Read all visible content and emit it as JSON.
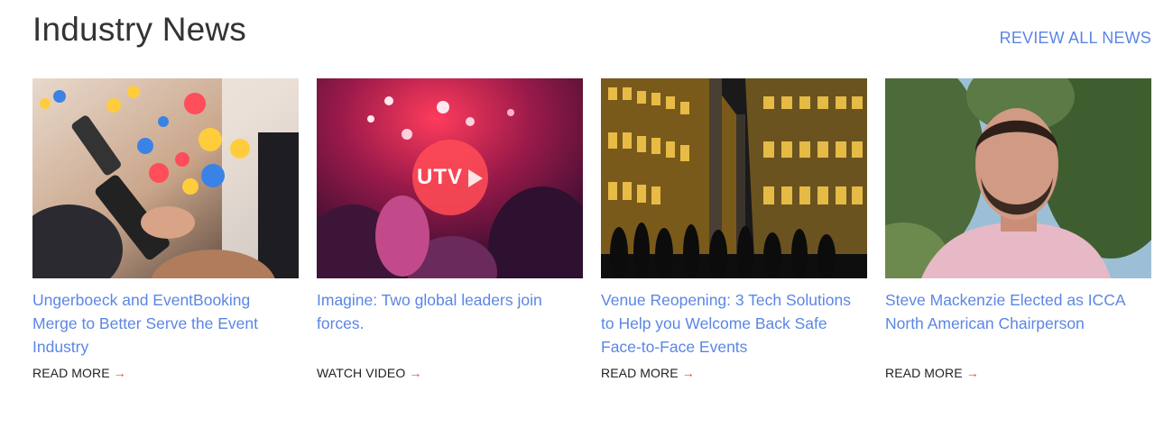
{
  "section": {
    "title": "Industry News",
    "review_all_label": "REVIEW ALL NEWS"
  },
  "colors": {
    "accent": "#5b86e5",
    "arrow": "#e8463a",
    "title": "#333333"
  },
  "cards": [
    {
      "title": "Ungerboeck and EventBooking Merge to Better Serve the Event Industry",
      "link_label": "READ MORE",
      "image": "phone-social-reactions-photo"
    },
    {
      "title": "Imagine: Two global leaders join forces.",
      "link_label": "WATCH VIDEO",
      "image": "concert-crowd-video-thumbnail",
      "overlay_text": "UTV"
    },
    {
      "title": "Venue Reopening: 3 Tech Solutions to Help you Welcome Back Safe Face-to-Face Events",
      "link_label": "READ MORE",
      "image": "venue-night-crowd-photo"
    },
    {
      "title": "Steve Mackenzie Elected as ICCA North American Chairperson",
      "link_label": "READ MORE",
      "image": "man-portrait-photo"
    }
  ]
}
